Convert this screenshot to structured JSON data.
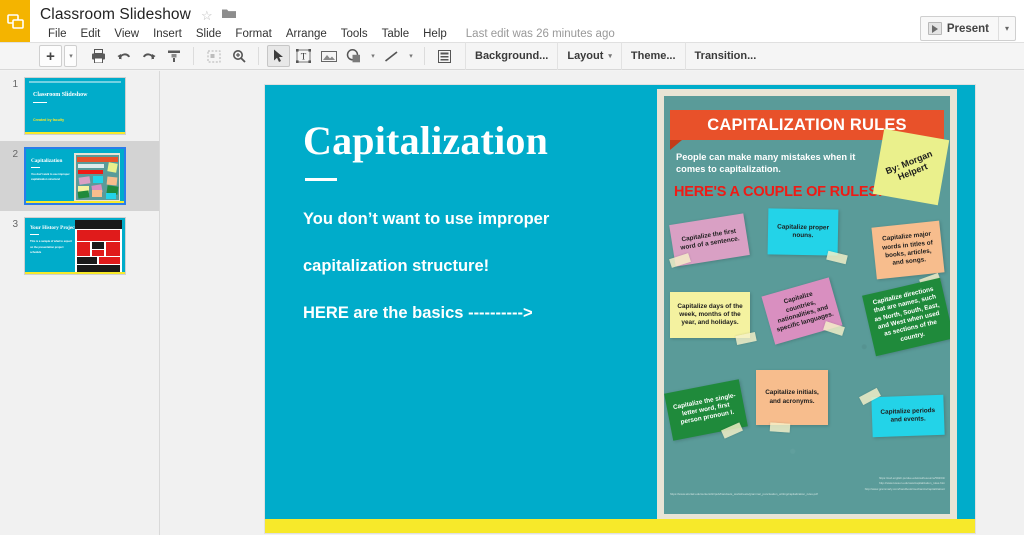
{
  "header": {
    "app_icon": "slides-icon",
    "doc_title": "Classroom Slideshow",
    "star_icon": "star-icon",
    "folder_icon": "folder-icon",
    "menus": [
      "File",
      "Edit",
      "View",
      "Insert",
      "Slide",
      "Format",
      "Arrange",
      "Tools",
      "Table",
      "Help"
    ],
    "last_edit": "Last edit was 26 minutes ago",
    "present_label": "Present",
    "present_caret": "▾"
  },
  "toolbar": {
    "new_slide_label": "+",
    "new_slide_caret": "▾",
    "print_icon": "print-icon",
    "undo_icon": "undo-icon",
    "redo_icon": "redo-icon",
    "paint_format_icon": "paint-format-icon",
    "fit_icon": "fit-to-window-icon",
    "zoom_icon": "zoom-icon",
    "select_icon": "select-arrow-icon",
    "textbox_icon": "text-box-icon",
    "image_icon": "insert-image-icon",
    "shape_icon": "shape-icon",
    "shape_caret": "▾",
    "line_icon": "line-icon",
    "line_caret": "▾",
    "layout_icon": "layout-icon",
    "background_label": "Background...",
    "layout_label": "Layout",
    "layout_caret": "▾",
    "theme_label": "Theme...",
    "transition_label": "Transition..."
  },
  "filmstrip": {
    "slides": [
      {
        "number": "1",
        "title": "Classroom Slideshow",
        "subtitle": "Created by faculty",
        "selected": false
      },
      {
        "number": "2",
        "title": "Capitalization",
        "subtitle": "You don't want to use improper capitalization structure!",
        "selected": true
      },
      {
        "number": "3",
        "title": "Your History Project",
        "subtitle": "This is a sample of what to expect on the presentation project schedule",
        "selected": false
      }
    ]
  },
  "slide": {
    "title": "Capitalization",
    "body_lines": [
      "You don’t want to use improper",
      "capitalization structure!",
      "HERE are the basics ---------->"
    ],
    "background_color": "#00acca",
    "accent_bar_color": "#f7e92a"
  },
  "poster": {
    "banner_title": "CAPITALIZATION RULES",
    "subtitle": "People can make many mistakes when it comes to capitalization.",
    "hook": "HERE'S A COUPLE OF RULES!",
    "byline": "By: Morgan Helpert",
    "notes": [
      {
        "text": "Capitalize the first word of a sentence.",
        "color": "#d9a0c4"
      },
      {
        "text": "Capitalize proper nouns.",
        "color": "#23d3e8"
      },
      {
        "text": "Capitalize major words in titles of books, articles, and songs.",
        "color": "#f7bd8d"
      },
      {
        "text": "Capitalize days of the week, months of the year, and holidays.",
        "color": "#f4f2a0"
      },
      {
        "text": "Capitalize countries, nationalities, and specific languages.",
        "color": "#d98fc0"
      },
      {
        "text": "Capitalize directions that are names, such as North, South, East, and West when used as sections of the country.",
        "color": "#1f8a3b"
      },
      {
        "text": "Capitalize the single-letter word, first person pronoun I.",
        "color": "#1f8a3b"
      },
      {
        "text": "Capitalize initials, and acronyms.",
        "color": "#f7bd8d"
      },
      {
        "text": "Capitalize periods and events.",
        "color": "#23d3e8"
      }
    ],
    "credits": [
      "https://owl.english.purdue.edu/owl/resource/592/01/",
      "http://www.towson.edu/ows/capitalization_rules.htm",
      "http://www.grammarly.com/handbook/mechanics/capitalization/",
      "https://www.sinclair.edu/centers/tlc/pub/handouts_worksheets/grammar_punctuation_writing/capitalization_rules.pdf"
    ]
  }
}
